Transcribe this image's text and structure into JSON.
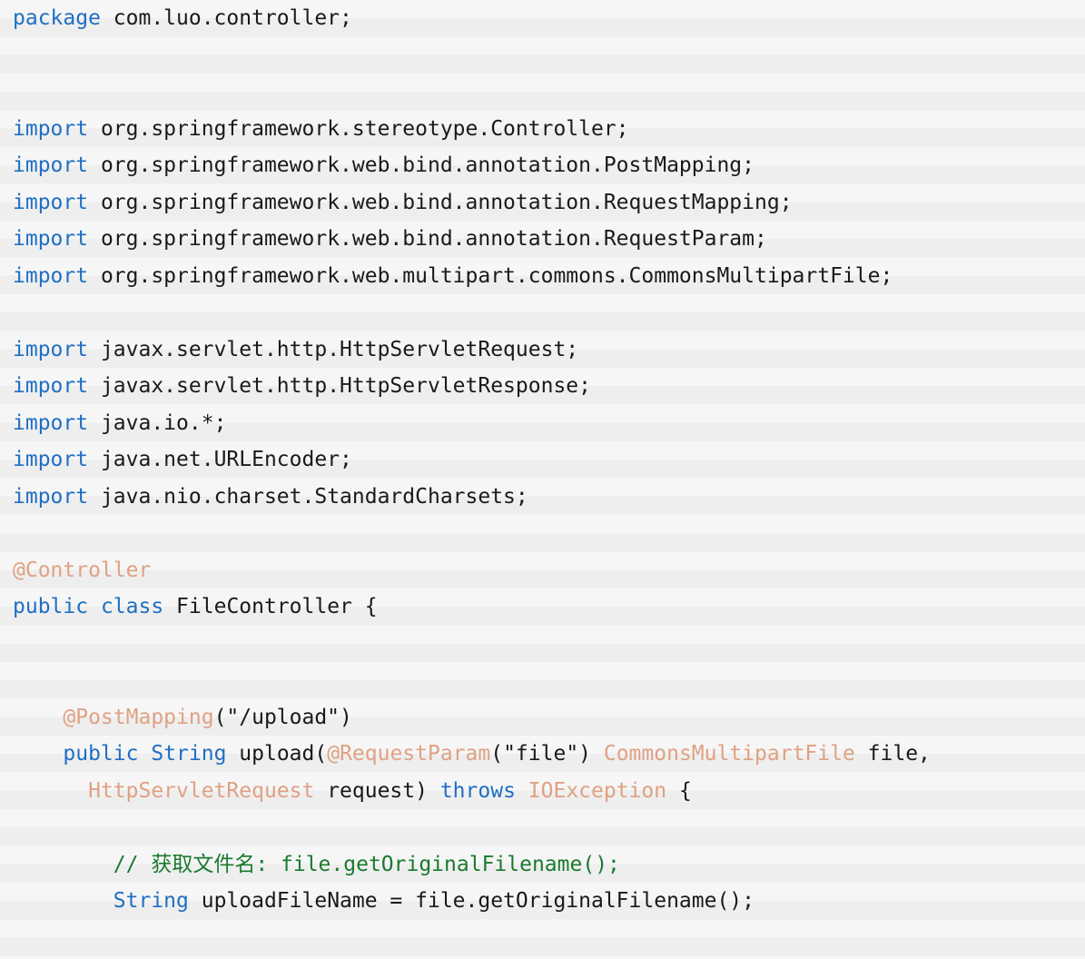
{
  "editor": {
    "language": "java",
    "background_color": "#f1f1f1",
    "colors": {
      "keyword": "#1f6fc4",
      "annotation": "#e0a183",
      "comment": "#1a7a2e",
      "plain": "#1a1a1a"
    }
  },
  "code": {
    "lines": [
      {
        "index": 0,
        "tokens": [
          {
            "t": "package",
            "k": "kw"
          },
          {
            "t": " com.luo.controller;",
            "k": "txt"
          }
        ]
      },
      {
        "index": 1,
        "tokens": []
      },
      {
        "index": 2,
        "tokens": []
      },
      {
        "index": 3,
        "tokens": [
          {
            "t": "import",
            "k": "kw"
          },
          {
            "t": " org.springframework.stereotype.Controller;",
            "k": "txt"
          }
        ]
      },
      {
        "index": 4,
        "tokens": [
          {
            "t": "import",
            "k": "kw"
          },
          {
            "t": " org.springframework.web.bind.annotation.PostMapping;",
            "k": "txt"
          }
        ]
      },
      {
        "index": 5,
        "tokens": [
          {
            "t": "import",
            "k": "kw"
          },
          {
            "t": " org.springframework.web.bind.annotation.RequestMapping;",
            "k": "txt"
          }
        ]
      },
      {
        "index": 6,
        "tokens": [
          {
            "t": "import",
            "k": "kw"
          },
          {
            "t": " org.springframework.web.bind.annotation.RequestParam;",
            "k": "txt"
          }
        ]
      },
      {
        "index": 7,
        "tokens": [
          {
            "t": "import",
            "k": "kw"
          },
          {
            "t": " org.springframework.web.multipart.commons.CommonsMultipartFile;",
            "k": "txt"
          }
        ]
      },
      {
        "index": 8,
        "tokens": []
      },
      {
        "index": 9,
        "tokens": [
          {
            "t": "import",
            "k": "kw"
          },
          {
            "t": " javax.servlet.http.HttpServletRequest;",
            "k": "txt"
          }
        ]
      },
      {
        "index": 10,
        "tokens": [
          {
            "t": "import",
            "k": "kw"
          },
          {
            "t": " javax.servlet.http.HttpServletResponse;",
            "k": "txt"
          }
        ]
      },
      {
        "index": 11,
        "tokens": [
          {
            "t": "import",
            "k": "kw"
          },
          {
            "t": " java.io.*;",
            "k": "txt"
          }
        ]
      },
      {
        "index": 12,
        "tokens": [
          {
            "t": "import",
            "k": "kw"
          },
          {
            "t": " java.net.URLEncoder;",
            "k": "txt"
          }
        ]
      },
      {
        "index": 13,
        "tokens": [
          {
            "t": "import",
            "k": "kw"
          },
          {
            "t": " java.nio.charset.StandardCharsets;",
            "k": "txt"
          }
        ]
      },
      {
        "index": 14,
        "tokens": []
      },
      {
        "index": 15,
        "tokens": [
          {
            "t": "@Controller",
            "k": "ann"
          }
        ]
      },
      {
        "index": 16,
        "tokens": [
          {
            "t": "public",
            "k": "kw"
          },
          {
            "t": " ",
            "k": "txt"
          },
          {
            "t": "class",
            "k": "kw"
          },
          {
            "t": " FileController {",
            "k": "txt"
          }
        ]
      },
      {
        "index": 17,
        "tokens": []
      },
      {
        "index": 18,
        "tokens": []
      },
      {
        "index": 19,
        "tokens": [
          {
            "t": "    ",
            "k": "txt"
          },
          {
            "t": "@PostMapping",
            "k": "ann"
          },
          {
            "t": "(\"/upload\")",
            "k": "txt"
          }
        ]
      },
      {
        "index": 20,
        "tokens": [
          {
            "t": "    ",
            "k": "txt"
          },
          {
            "t": "public",
            "k": "kw"
          },
          {
            "t": " ",
            "k": "txt"
          },
          {
            "t": "String",
            "k": "kw"
          },
          {
            "t": " upload(",
            "k": "txt"
          },
          {
            "t": "@RequestParam",
            "k": "ann"
          },
          {
            "t": "(\"file\") ",
            "k": "txt"
          },
          {
            "t": "CommonsMultipartFile",
            "k": "ann"
          },
          {
            "t": " file,",
            "k": "txt"
          }
        ]
      },
      {
        "index": 21,
        "tokens": [
          {
            "t": "      ",
            "k": "txt"
          },
          {
            "t": "HttpServletRequest",
            "k": "ann"
          },
          {
            "t": " request) ",
            "k": "txt"
          },
          {
            "t": "throws",
            "k": "kw"
          },
          {
            "t": " ",
            "k": "txt"
          },
          {
            "t": "IOException",
            "k": "ann"
          },
          {
            "t": " {",
            "k": "txt"
          }
        ]
      },
      {
        "index": 22,
        "tokens": []
      },
      {
        "index": 23,
        "tokens": [
          {
            "t": "        ",
            "k": "txt"
          },
          {
            "t": "// 获取文件名: file.getOriginalFilename();",
            "k": "cmt"
          }
        ]
      },
      {
        "index": 24,
        "tokens": [
          {
            "t": "        ",
            "k": "txt"
          },
          {
            "t": "String",
            "k": "kw"
          },
          {
            "t": " uploadFileName = file.getOriginalFilename();",
            "k": "txt"
          }
        ]
      }
    ]
  }
}
